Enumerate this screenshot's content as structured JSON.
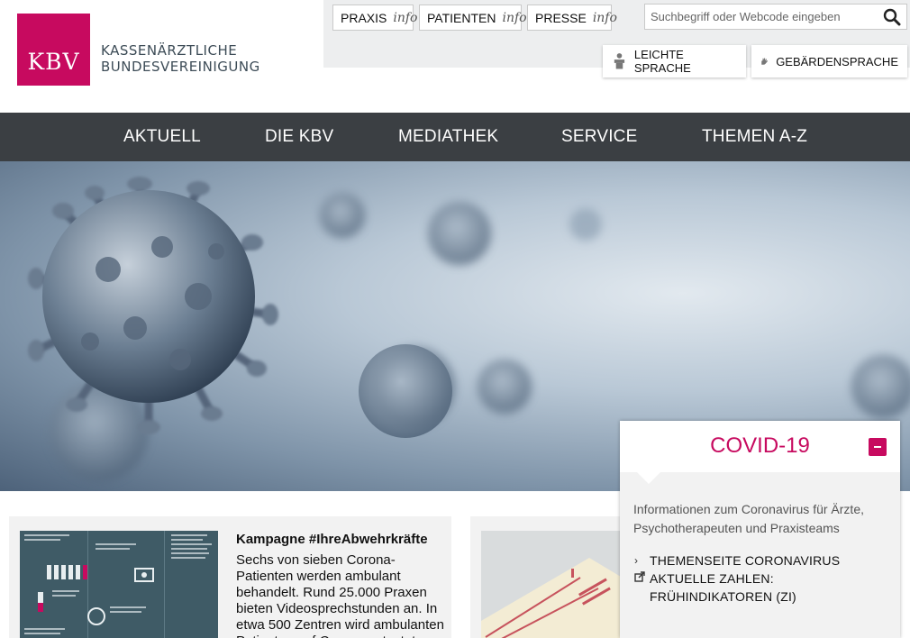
{
  "logo": {
    "mark": "KBV",
    "line1": "KASSENÄRZTLICHE",
    "line2": "BUNDESVEREINIGUNG",
    "brand_color": "#c70a5f"
  },
  "info_buttons": [
    {
      "label": "PRAXIS",
      "suffix": "info"
    },
    {
      "label": "PATIENTEN",
      "suffix": "info"
    },
    {
      "label": "PRESSE",
      "suffix": "info"
    }
  ],
  "search": {
    "placeholder": "Suchbegriff oder Webcode eingeben",
    "icon": "search-icon"
  },
  "accessibility": [
    {
      "label": "LEICHTE SPRACHE",
      "icon": "easy-language-icon"
    },
    {
      "label": "GEBÄRDENSPRACHE",
      "icon": "sign-language-icon"
    }
  ],
  "nav": {
    "items": [
      {
        "label": "AKTUELL"
      },
      {
        "label": "DIE KBV"
      },
      {
        "label": "MEDIATHEK"
      },
      {
        "label": "SERVICE"
      },
      {
        "label": "THEMEN A-Z"
      }
    ],
    "bg_color": "#3b3f43"
  },
  "covid_panel": {
    "title": "COVID-19",
    "description": "Informationen zum Coronavirus für Ärzte, Psychotherapeuten und Praxisteams",
    "links": [
      {
        "label": "THEMENSEITE CORONAVIRUS",
        "icon": "chevron-right-icon"
      },
      {
        "label": "AKTUELLE ZAHLEN: FRÜHINDIKATOREN (ZI)",
        "icon": "external-link-icon"
      }
    ]
  },
  "campaign_card": {
    "title": "Kampagne #IhreAbwehrkräfte",
    "text": "Sechs von sieben Corona-Patienten werden ambulant behandelt. Rund 25.000 Praxen bieten Videosprechstunden an. In etwa 500 Zentren wird ambulanten Patienten auf Corona getestet."
  }
}
